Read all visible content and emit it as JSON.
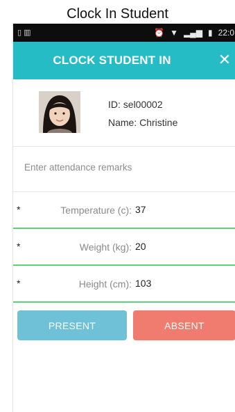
{
  "page_heading": "Clock In Student",
  "status_bar": {
    "left_icons": "▯ ▥",
    "alarm_icon": "⏰",
    "wifi_icon": "▼",
    "signal_icon": "▂▄▆",
    "battery_icon": "▮",
    "time": "22:0"
  },
  "header": {
    "title": "CLOCK STUDENT IN",
    "close_glyph": "✕"
  },
  "student": {
    "id_text": "ID: sel00002",
    "name_text": "Name: Christine"
  },
  "remarks": {
    "placeholder": "Enter attendance remarks",
    "value": ""
  },
  "fields": [
    {
      "required_mark": "*",
      "label": "Temperature (c):",
      "value": "37"
    },
    {
      "required_mark": "*",
      "label": "Weight (kg):",
      "value": "20"
    },
    {
      "required_mark": "*",
      "label": "Height (cm):",
      "value": "103"
    }
  ],
  "actions": {
    "present_label": "PRESENT",
    "absent_label": "ABSENT"
  },
  "colors": {
    "header": "#26bcc5",
    "present": "#6ec1d6",
    "absent": "#f07b6f",
    "field_underline": "#5cd27a"
  }
}
